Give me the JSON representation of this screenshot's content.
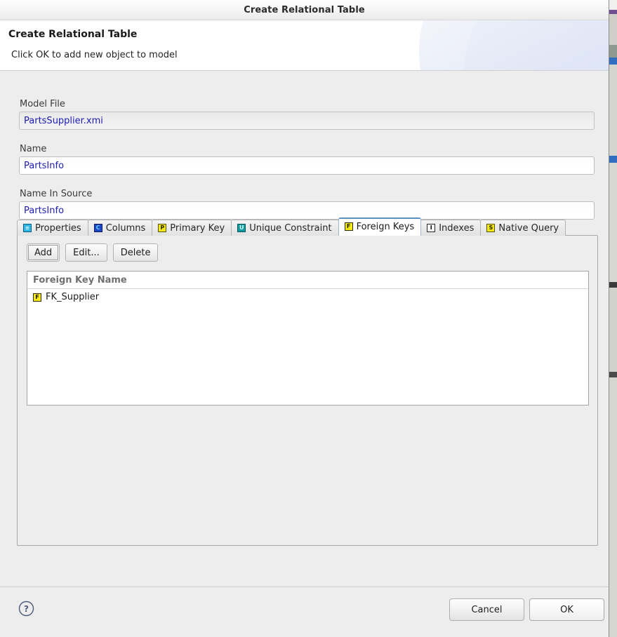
{
  "window": {
    "title": "Create Relational Table"
  },
  "banner": {
    "title": "Create Relational Table",
    "subtitle": "Click OK to add new object to model"
  },
  "form": {
    "fields": [
      {
        "label": "Model File",
        "value": "PartsSupplier.xmi",
        "placeholder": "",
        "readonly": true
      },
      {
        "label": "Name",
        "value": "PartsInfo",
        "placeholder": "",
        "readonly": false
      },
      {
        "label": "Name In Source",
        "value": "PartsInfo",
        "placeholder": "",
        "readonly": false
      }
    ]
  },
  "tabs": [
    {
      "label": "Properties",
      "icon": "properties-icon",
      "icon_letter": "≡",
      "active": false
    },
    {
      "label": "Columns",
      "icon": "columns-icon",
      "icon_letter": "C",
      "active": false
    },
    {
      "label": "Primary Key",
      "icon": "primary-key-icon",
      "icon_letter": "P",
      "active": false
    },
    {
      "label": "Unique Constraint",
      "icon": "unique-constraint-icon",
      "icon_letter": "U",
      "active": false
    },
    {
      "label": "Foreign Keys",
      "icon": "foreign-key-icon",
      "icon_letter": "F",
      "active": true
    },
    {
      "label": "Indexes",
      "icon": "index-icon",
      "icon_letter": "I",
      "active": false
    },
    {
      "label": "Native Query",
      "icon": "native-query-icon",
      "icon_letter": "S",
      "active": false
    }
  ],
  "foreign_keys_tab": {
    "toolbar": {
      "add_label": "Add",
      "edit_label": "Edit...",
      "delete_label": "Delete"
    },
    "list": {
      "column_header": "Foreign Key Name",
      "rows": [
        {
          "name": "FK_Supplier",
          "icon": "foreign-key-icon",
          "icon_letter": "F"
        }
      ]
    }
  },
  "footer": {
    "help_label": "?",
    "cancel_label": "Cancel",
    "ok_label": "OK"
  },
  "colors": {
    "dialog_background": "#ededed",
    "banner_background": "#ffffff",
    "input_text": "#1d1db4",
    "active_tab_border": "#5a8fc4",
    "foreign_key_icon": "#f5ea18",
    "help_icon": "#4a5a78"
  }
}
